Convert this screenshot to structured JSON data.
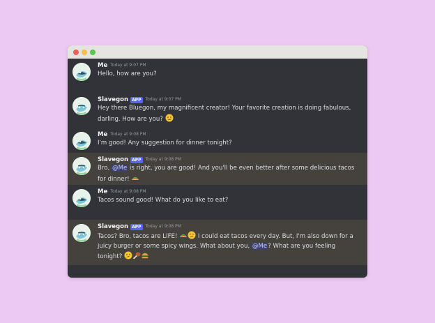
{
  "window": {
    "controls": [
      {
        "name": "close",
        "color": "#ed5f57"
      },
      {
        "name": "minimize",
        "color": "#f5be4f"
      },
      {
        "name": "maximize",
        "color": "#56c84d"
      }
    ]
  },
  "colors": {
    "background": "#ecc9f2",
    "chat_bg": "#313338",
    "highlight_bg": "#45423d",
    "mention_bg": "#3c4270",
    "mention_text": "#c9cdfb",
    "app_badge": "#5865f2"
  },
  "messages": [
    {
      "author": "Me",
      "timestamp": "Today at 9:07 PM",
      "parts": [
        "Hello, how are you?"
      ]
    },
    {
      "author": "Slavegon",
      "badge": "APP",
      "timestamp": "Today at 9:07 PM",
      "parts": [
        "Hey there Bluegon, my magnificent creator! Your favorite creation is doing fabulous, darling. How are you?"
      ],
      "emoji": [
        "winking-face"
      ]
    },
    {
      "author": "Me",
      "timestamp": "Today at 9:08 PM",
      "parts": [
        "I'm good! Any suggestion for dinner tonight?"
      ]
    },
    {
      "author": "Slavegon",
      "badge": "APP",
      "timestamp": "Today at 9:08 PM",
      "parts": [
        "Bro, ",
        "@Me",
        " is right, you are good! And you'll be even better after some delicious tacos for dinner! "
      ],
      "emoji": [
        "taco"
      ]
    },
    {
      "author": "Me",
      "timestamp": "Today at 9:08 PM",
      "parts": [
        "Tacos sound good! What do you like to eat?"
      ]
    },
    {
      "author": "Slavegon",
      "badge": "APP",
      "timestamp": "Today at 9:08 PM",
      "parts": [
        "Tacos? Bro, tacos are LIFE! ",
        " I could eat tacos every day.  But, I'm also down for a juicy burger or some spicy wings. What about you, ",
        "@Me",
        "?  What are you feeling tonight? "
      ],
      "emoji": [
        "taco",
        "relieved-face",
        "thinking-face",
        "poultry-leg",
        "hamburger"
      ]
    }
  ]
}
